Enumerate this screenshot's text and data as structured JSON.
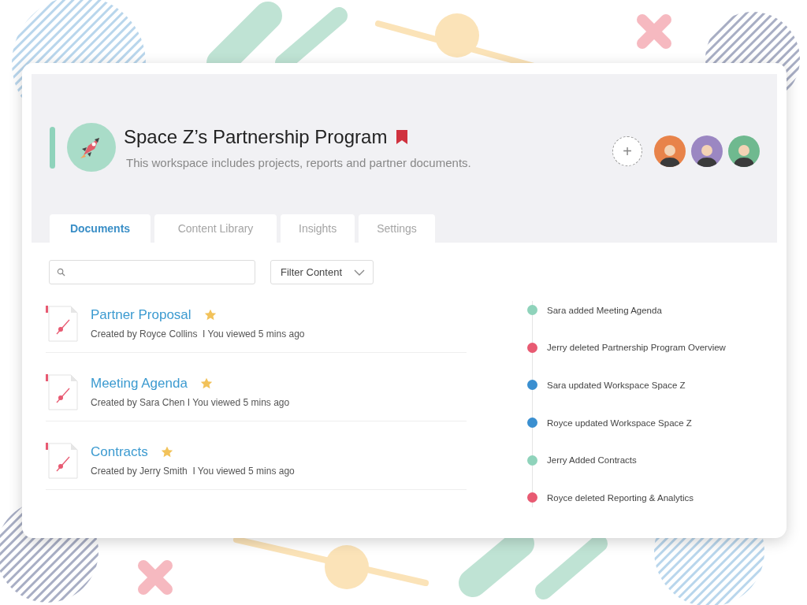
{
  "workspace": {
    "title": "Space Z’s Partnership Program",
    "bookmarked": true,
    "description": "This workspace includes projects, reports and partner documents."
  },
  "add_member_button": "+",
  "members": [
    {
      "color": "#e8834a"
    },
    {
      "color": "#9b87c2"
    },
    {
      "color": "#6fb98f"
    }
  ],
  "tabs": [
    {
      "label": "Documents",
      "selected": true
    },
    {
      "label": "Content Library",
      "selected": false
    },
    {
      "label": "Insights",
      "selected": false
    },
    {
      "label": "Settings",
      "selected": false
    }
  ],
  "filter": {
    "label": "Filter Content"
  },
  "documents": [
    {
      "title": "Partner Proposal",
      "starred": true,
      "meta": "Created by Royce Collins  I You viewed 5 mins ago"
    },
    {
      "title": "Meeting Agenda",
      "starred": true,
      "meta": "Created by Sara Chen I You viewed 5 mins ago"
    },
    {
      "title": "Contracts",
      "starred": true,
      "meta": "Created by Jerry Smith  I You viewed 5 mins ago"
    }
  ],
  "activity": [
    {
      "text": "Sara added Meeting Agenda",
      "color": "#8fd3bb"
    },
    {
      "text": "Jerry deleted Partnership Program Overview",
      "color": "#e85a72"
    },
    {
      "text": "Sara updated Workspace Space Z",
      "color": "#3a8fd0"
    },
    {
      "text": "Royce updated Workspace Space Z",
      "color": "#3a8fd0"
    },
    {
      "text": "Jerry Added Contracts",
      "color": "#8fd3bb"
    },
    {
      "text": "Royce deleted Reporting & Analytics",
      "color": "#e85a72"
    }
  ]
}
